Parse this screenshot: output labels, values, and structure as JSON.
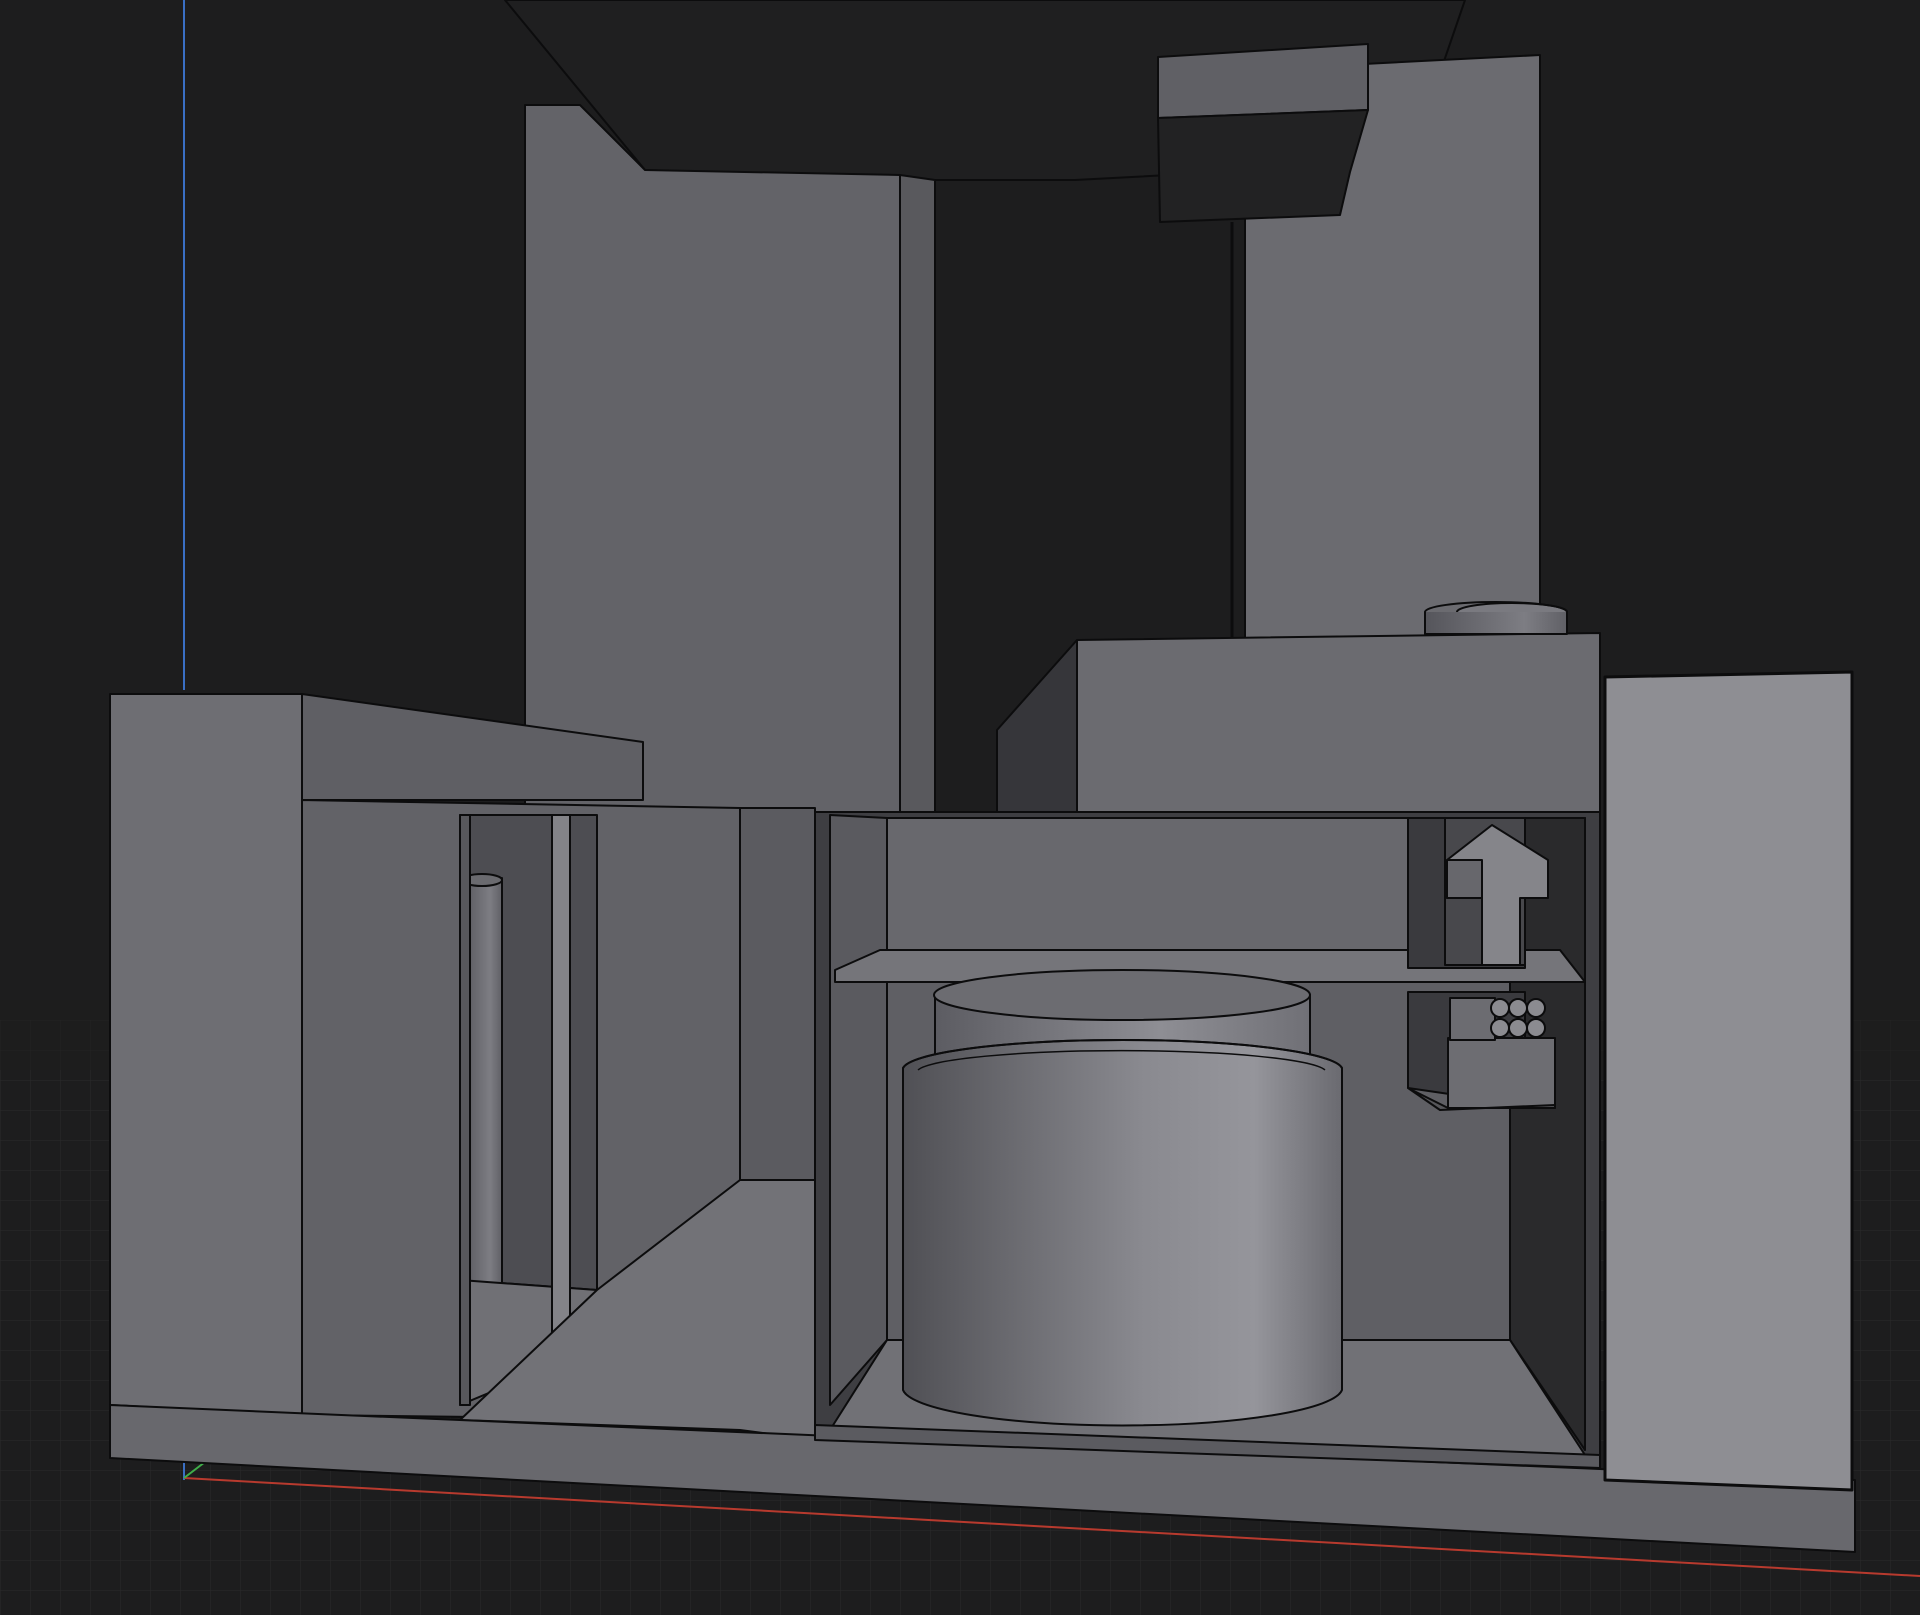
{
  "app": {
    "view": "3D viewport",
    "shading": "solid"
  },
  "colors": {
    "background": "#1c1c1d",
    "grid_line": "#2c2c2e",
    "axis_x": "#c0392b",
    "axis_y": "#3a6fc4",
    "axis_z": "#3fae49",
    "outline": "#0c0c0d"
  },
  "icons": []
}
